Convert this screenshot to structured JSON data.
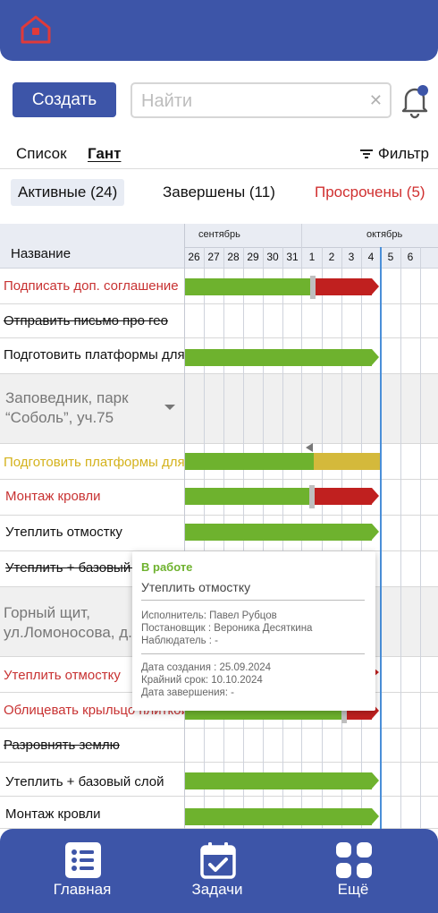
{
  "toolbar": {
    "create_label": "Создать",
    "search_placeholder": "Найти"
  },
  "view_tabs": {
    "list": "Список",
    "gantt": "Гант",
    "filter": "Фильтр"
  },
  "status_tabs": {
    "active": "Активные (24)",
    "completed": "Завершены (11)",
    "overdue": "Просрочены (5)"
  },
  "gantt": {
    "name_header": "Название",
    "months": [
      "сентябрь",
      "октябрь"
    ],
    "days": [
      "26",
      "27",
      "28",
      "29",
      "30",
      "31",
      "1",
      "2",
      "3",
      "4",
      "5",
      "6"
    ],
    "rows": [
      {
        "name": "Подписать доп. соглашение"
      },
      {
        "name": "Отправить письмо про гео"
      },
      {
        "name": "Подготовить платформы для"
      },
      {
        "name": "Заповедник, парк\n“Соболь”, уч.75"
      },
      {
        "name": "Подготовить платформы для"
      },
      {
        "name": "Монтаж кровли"
      },
      {
        "name": "Утеплить отмостку"
      },
      {
        "name": "Утеплить + базовый слой"
      },
      {
        "name": "Горный щит,\nул.Ломоносова, д.5"
      },
      {
        "name": "Утеплить отмостку"
      },
      {
        "name": "Облицевать крыльцо плиткой"
      },
      {
        "name": "Разровнять землю"
      },
      {
        "name": "Утеплить + базовый слой"
      },
      {
        "name": "Монтаж кровли"
      }
    ]
  },
  "tooltip": {
    "status": "В работе",
    "title": "Утеплить отмостку",
    "assignee": "Исполнитель: Павел Рубцов",
    "setter": "Постановщик : Вероника Десяткина",
    "observer": "Наблюдатель : -",
    "created": "Дата создания : 25.09.2024",
    "deadline": "Крайний срок: 10.10.2024",
    "completed": "Дата завершения: -"
  },
  "bottom_nav": {
    "home": "Главная",
    "tasks": "Задачи",
    "more": "Ещё"
  },
  "colors": {
    "brand": "#3d55a8",
    "progress": "#6eb22e",
    "overdue": "#c0201f",
    "warning": "#d4b93b",
    "today": "#4a8fd8"
  }
}
